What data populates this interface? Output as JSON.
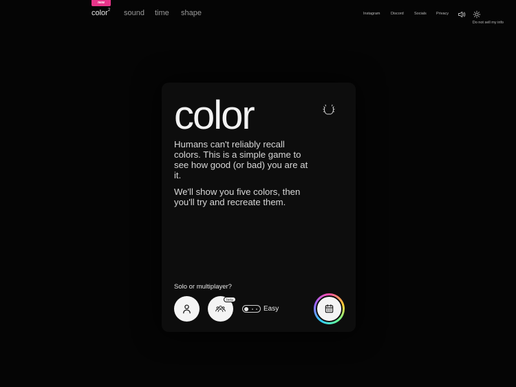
{
  "nav": {
    "badge": "new",
    "items": [
      {
        "label": "color",
        "sup": "2"
      },
      {
        "label": "sound"
      },
      {
        "label": "time"
      },
      {
        "label": "shape"
      }
    ],
    "links": [
      "Instagram",
      "Discord",
      "Socials",
      "Privacy"
    ],
    "do_not_sell": "Do not sell my info",
    "icons": [
      "volume-icon",
      "sun-icon"
    ]
  },
  "card": {
    "title": "color",
    "desc1": "Humans can't reliably recall colors. This is a simple game to see how good (or bad) you are at it.",
    "desc2": "We'll show you five colors, then you'll try and recreate them.",
    "solo_label": "Solo or multiplayer?",
    "beta": "beta",
    "difficulty": "Easy"
  },
  "colors": {
    "background": "#050505",
    "card": "#0d0d0d",
    "accent_pink": "#e8358a",
    "button": "#f4f4f4"
  }
}
